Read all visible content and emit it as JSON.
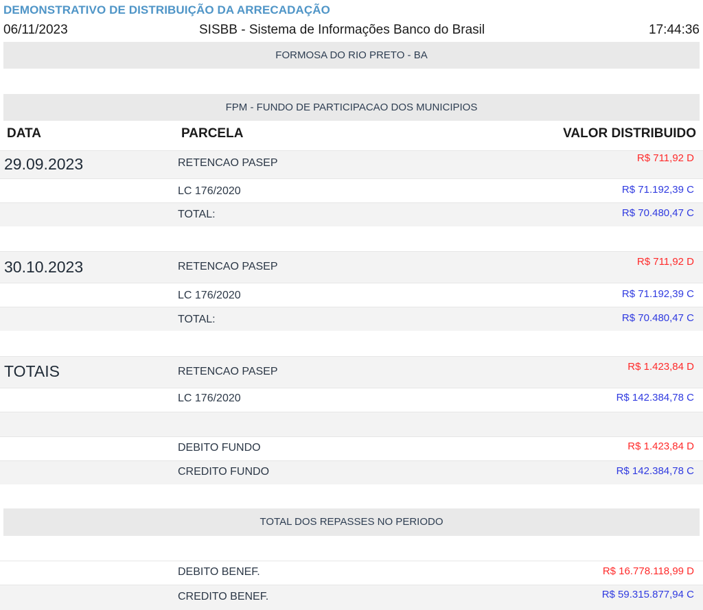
{
  "header": {
    "title": "DEMONSTRATIVO DE DISTRIBUIÇÃO DA ARRECADAÇÃO",
    "date": "06/11/2023",
    "system": "SISBB - Sistema de Informações Banco do Brasil",
    "time": "17:44:36"
  },
  "municipality": "FORMOSA DO RIO PRETO - BA",
  "fund": "FPM - FUNDO DE PARTICIPACAO DOS MUNICIPIOS",
  "columns": {
    "date": "DATA",
    "parcel": "PARCELA",
    "value": "VALOR DISTRIBUIDO"
  },
  "groups": [
    {
      "date": "29.09.2023",
      "rows": [
        {
          "parcel": "RETENCAO PASEP",
          "value": "R$ 711,92 D",
          "type": "debit"
        },
        {
          "parcel": "LC 176/2020",
          "value": "R$ 71.192,39 C",
          "type": "credit"
        },
        {
          "parcel": "TOTAL:",
          "value": "R$ 70.480,47 C",
          "type": "credit"
        }
      ]
    },
    {
      "date": "30.10.2023",
      "rows": [
        {
          "parcel": "RETENCAO PASEP",
          "value": "R$ 711,92 D",
          "type": "debit"
        },
        {
          "parcel": "LC 176/2020",
          "value": "R$ 71.192,39 C",
          "type": "credit"
        },
        {
          "parcel": "TOTAL:",
          "value": "R$ 70.480,47 C",
          "type": "credit"
        }
      ]
    }
  ],
  "totals": {
    "label": "TOTAIS",
    "rows": [
      {
        "parcel": "RETENCAO PASEP",
        "value": "R$ 1.423,84 D",
        "type": "debit"
      },
      {
        "parcel": "LC 176/2020",
        "value": "R$ 142.384,78 C",
        "type": "credit"
      }
    ],
    "fund_rows": [
      {
        "parcel": "DEBITO FUNDO",
        "value": "R$ 1.423,84 D",
        "type": "debit"
      },
      {
        "parcel": "CREDITO FUNDO",
        "value": "R$ 142.384,78 C",
        "type": "credit"
      }
    ]
  },
  "period": {
    "title": "TOTAL DOS REPASSES NO PERIODO",
    "rows": [
      {
        "parcel": "DEBITO BENEF.",
        "value": "R$ 16.778.118,99 D",
        "type": "debit"
      },
      {
        "parcel": "CREDITO BENEF.",
        "value": "R$ 59.315.877,94 C",
        "type": "credit"
      }
    ]
  },
  "colors": {
    "title": "#4f95c7",
    "debit": "#ff2a2a",
    "credit": "#2f3ae0",
    "bar": "#e9e9e9"
  }
}
